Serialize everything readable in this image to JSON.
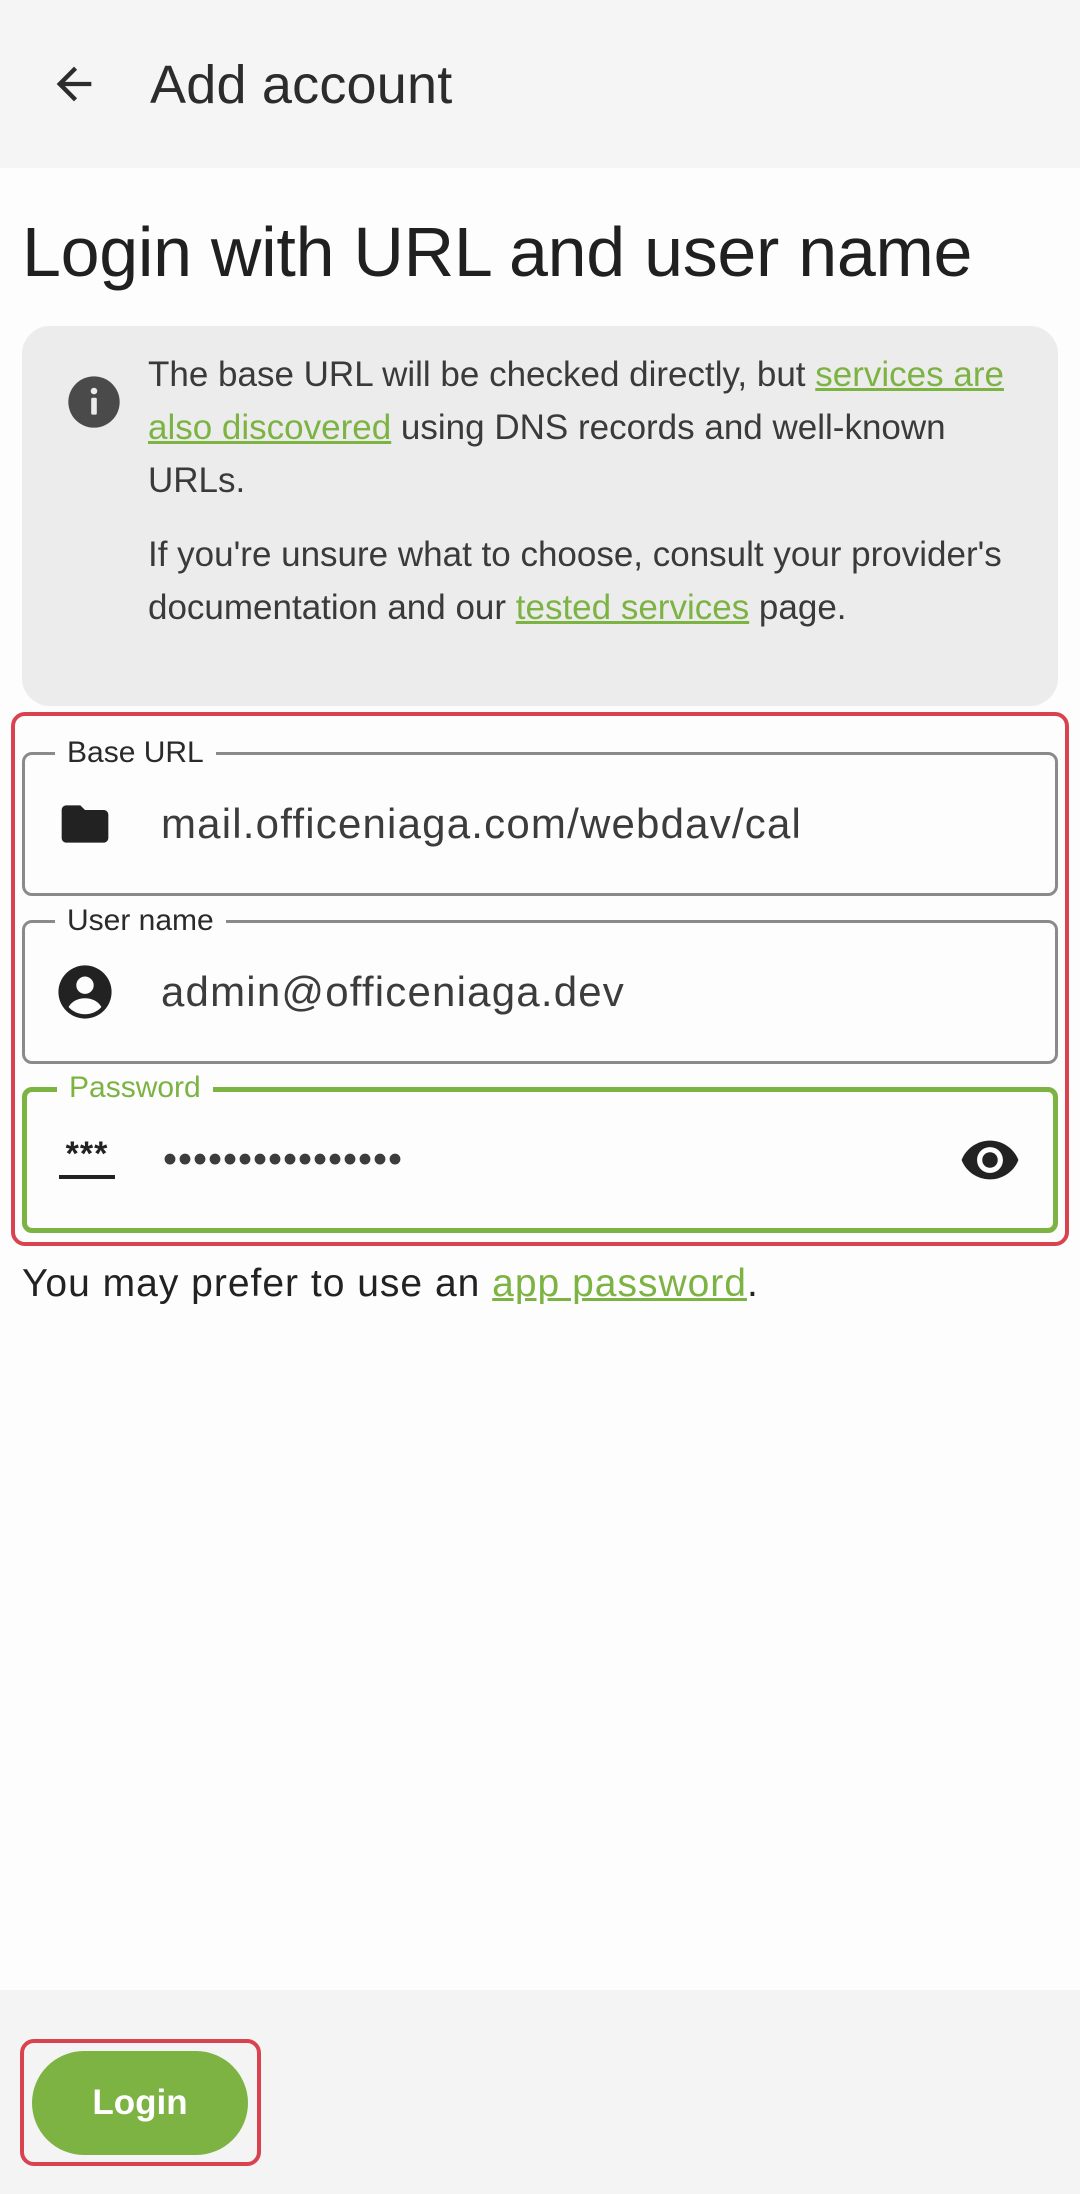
{
  "appbar": {
    "title": "Add account"
  },
  "page": {
    "title": "Login with URL and user name"
  },
  "info": {
    "p1_pre": "The base URL will be checked directly, but ",
    "p1_link": "services are also discovered",
    "p1_post": " using DNS records and well-known URLs.",
    "p2_pre": "If you're unsure what to choose, consult your provider's documentation and our ",
    "p2_link": "tested services",
    "p2_post": " page."
  },
  "fields": {
    "base_url": {
      "label": "Base URL",
      "value": "mail.officeniaga.com/webdav/cal"
    },
    "user_name": {
      "label": "User name",
      "value": "admin@officeniaga.dev"
    },
    "password": {
      "label": "Password",
      "value": "••••••••••••••••",
      "icon_text": "***"
    }
  },
  "hint": {
    "pre": "You may prefer to use an ",
    "link": "app password",
    "post": "."
  },
  "actions": {
    "login_label": "Login"
  },
  "colors": {
    "accent": "#7cb342",
    "highlight": "#d9434f"
  }
}
